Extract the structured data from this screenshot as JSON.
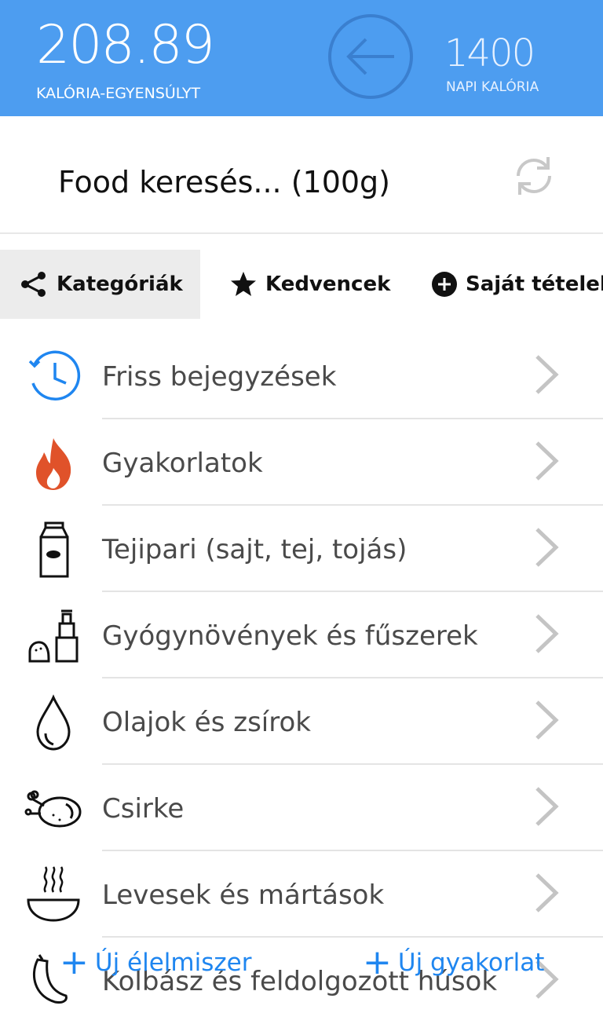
{
  "header": {
    "balance_value": "208.89",
    "balance_label": "KALÓRIA-EGYENSÚLYT",
    "daily_value": "1400",
    "daily_label": "NAPI KALÓRIA",
    "color": "#4d9df0"
  },
  "search": {
    "text": "Food keresés... (100g)"
  },
  "tabs": [
    {
      "label": "Kategóriák",
      "icon": "share-icon",
      "active": true
    },
    {
      "label": "Kedvencek",
      "icon": "star-icon",
      "active": false
    },
    {
      "label": "Saját tételek",
      "icon": "plus-circle-icon",
      "active": false
    }
  ],
  "categories": [
    {
      "label": "Friss bejegyzések",
      "icon": "history-clock-icon"
    },
    {
      "label": "Gyakorlatok",
      "icon": "flame-icon"
    },
    {
      "label": "Tejipari (sajt, tej, tojás)",
      "icon": "milk-carton-icon"
    },
    {
      "label": "Gyógynövények és fűszerek",
      "icon": "salt-pepper-icon"
    },
    {
      "label": "Olajok és zsírok",
      "icon": "oil-drop-icon"
    },
    {
      "label": "Csirke",
      "icon": "roast-chicken-icon"
    },
    {
      "label": "Levesek és mártások",
      "icon": "soup-bowl-icon"
    },
    {
      "label": "Kolbász és feldolgozott húsok",
      "icon": "sausage-icon"
    }
  ],
  "bottom": {
    "new_food": "Új élelmiszer",
    "new_exercise": "Új gyakorlat",
    "accent": "#1f86f0"
  }
}
